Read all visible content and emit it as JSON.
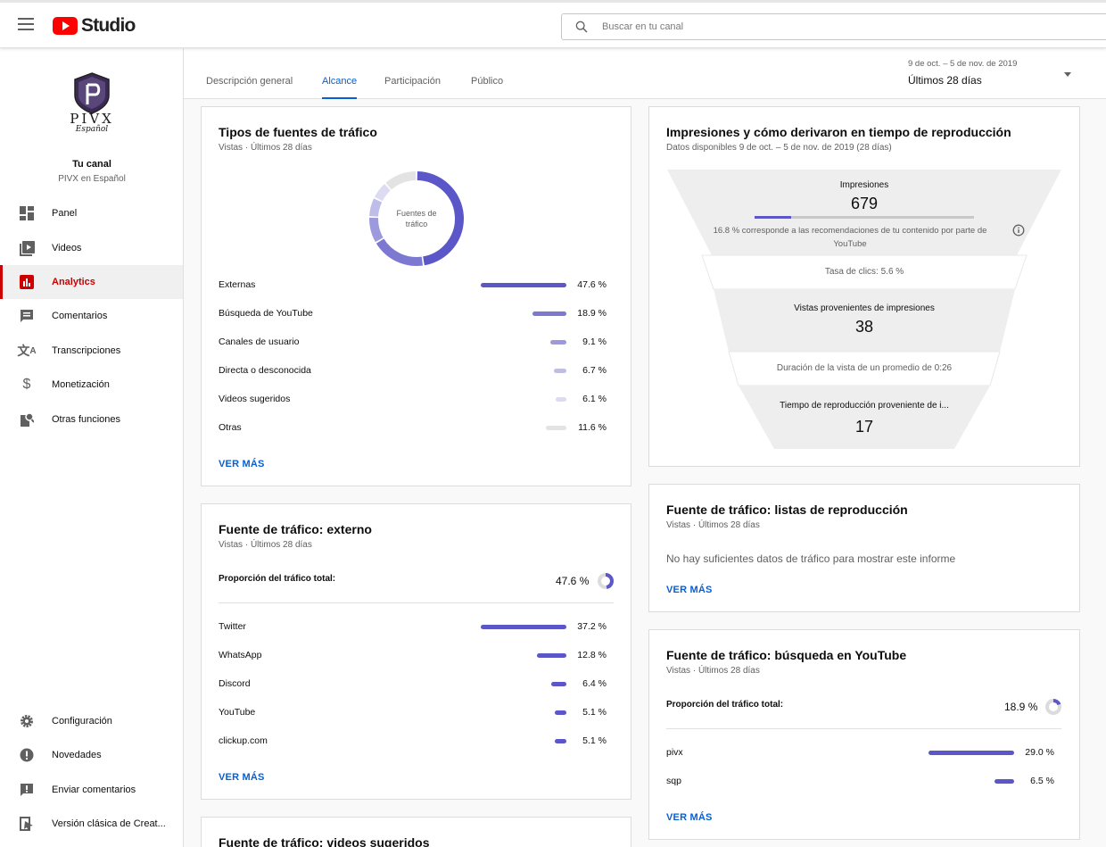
{
  "header": {
    "app_name": "Studio",
    "search_placeholder": "Buscar en tu canal"
  },
  "channel": {
    "logo_text": "PIVX",
    "logo_sub": "Español",
    "title": "Tu canal",
    "name": "PIVX en Español"
  },
  "sidebar": {
    "items": [
      {
        "label": "Panel",
        "icon": "dashboard-icon"
      },
      {
        "label": "Videos",
        "icon": "video-library-icon"
      },
      {
        "label": "Analytics",
        "icon": "analytics-icon",
        "active": true
      },
      {
        "label": "Comentarios",
        "icon": "comment-icon"
      },
      {
        "label": "Transcripciones",
        "icon": "translate-icon"
      },
      {
        "label": "Monetización",
        "icon": "dollar-icon"
      },
      {
        "label": "Otras funciones",
        "icon": "tools-icon"
      }
    ],
    "bottom_items": [
      {
        "label": "Configuración",
        "icon": "gear-icon"
      },
      {
        "label": "Novedades",
        "icon": "alert-badge-icon"
      },
      {
        "label": "Enviar comentarios",
        "icon": "feedback-icon"
      },
      {
        "label": "Versión clásica de Creat...",
        "icon": "classic-studio-icon"
      }
    ]
  },
  "tabs": [
    "Descripción general",
    "Alcance",
    "Participación",
    "Público"
  ],
  "active_tab": "Alcance",
  "date_range": {
    "range": "9 de oct. – 5 de nov. de 2019",
    "label": "Últimos 28 días"
  },
  "traffic_types": {
    "title": "Tipos de fuentes de tráfico",
    "subtitle": "Vistas · Últimos 28 días",
    "donut_label": "Fuentes de tráfico",
    "rows": [
      {
        "name": "Externas",
        "pct": "47.6 %",
        "value": 47.6,
        "color": "#5b57c8"
      },
      {
        "name": "Búsqueda de YouTube",
        "pct": "18.9 %",
        "value": 18.9,
        "color": "#7d79d2"
      },
      {
        "name": "Canales de usuario",
        "pct": "9.1 %",
        "value": 9.1,
        "color": "#9c99dd"
      },
      {
        "name": "Directa o desconocida",
        "pct": "6.7 %",
        "value": 6.7,
        "color": "#bebce8"
      },
      {
        "name": "Videos sugeridos",
        "pct": "6.1 %",
        "value": 6.1,
        "color": "#dcdbf2"
      },
      {
        "name": "Otras",
        "pct": "11.6 %",
        "value": 11.6,
        "color": "#e3e3e3"
      }
    ],
    "more": "VER MÁS"
  },
  "external": {
    "title": "Fuente de tráfico: externo",
    "subtitle": "Vistas · Últimos 28 días",
    "share_label": "Proporción del tráfico total:",
    "share": "47.6 %",
    "share_value": 47.6,
    "rows": [
      {
        "name": "Twitter",
        "pct": "37.2 %",
        "value": 37.2
      },
      {
        "name": "WhatsApp",
        "pct": "12.8 %",
        "value": 12.8
      },
      {
        "name": "Discord",
        "pct": "6.4 %",
        "value": 6.4
      },
      {
        "name": "YouTube",
        "pct": "5.1 %",
        "value": 5.1
      },
      {
        "name": "clickup.com",
        "pct": "5.1 %",
        "value": 5.1
      }
    ],
    "more": "VER MÁS"
  },
  "suggested": {
    "title": "Fuente de tráfico: videos sugeridos"
  },
  "impressions": {
    "title": "Impresiones y cómo derivaron en tiempo de reproducción",
    "subtitle": "Datos disponibles 9 de oct. – 5 de nov. de 2019 (28 días)",
    "impressions_label": "Impresiones",
    "impressions_value": "679",
    "recommendation_share": 16.8,
    "recommendation_note": "16.8 % corresponde a las recomendaciones de tu contenido por parte de YouTube",
    "ctr": "Tasa de clics: 5.6 %",
    "views_label": "Vistas provenientes de impresiones",
    "views_value": "38",
    "avg_duration": "Duración de la vista de un promedio de 0:26",
    "watch_label": "Tiempo de reproducción proveniente de i...",
    "watch_value": "17"
  },
  "playlists": {
    "title": "Fuente de tráfico: listas de reproducción",
    "subtitle": "Vistas · Últimos 28 días",
    "empty": "No hay suficientes datos de tráfico para mostrar este informe",
    "more": "VER MÁS"
  },
  "yt_search": {
    "title": "Fuente de tráfico: búsqueda en YouTube",
    "subtitle": "Vistas · Últimos 28 días",
    "share_label": "Proporción del tráfico total:",
    "share": "18.9 %",
    "share_value": 18.9,
    "rows": [
      {
        "name": "pivx",
        "pct": "29.0 %",
        "value": 29.0
      },
      {
        "name": "sqp",
        "pct": "6.5 %",
        "value": 6.5
      }
    ],
    "more": "VER MÁS"
  },
  "colors": {
    "accent": "#065fd4",
    "bar": "#5b57c8",
    "active_nav": "#cc0000"
  }
}
